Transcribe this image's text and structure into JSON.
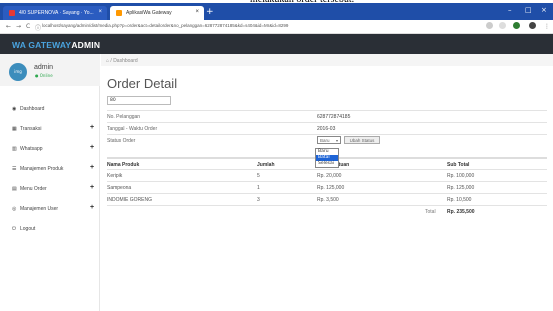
{
  "browser": {
    "tabs": [
      {
        "label": "4/0 SUPERNOVA · Sayang · Yo...",
        "close": "×"
      },
      {
        "label": "AplikasiWa Gateway",
        "close": "×"
      }
    ],
    "new_tab": "+",
    "controls": {
      "minimize": "–",
      "maximize": "□",
      "close": "×"
    },
    "nav": {
      "back": "←",
      "forward": "→",
      "reload": "C",
      "info": "ⓘ"
    },
    "url": "localhost/sayang/admin/dist/media.php?p=order&act=detailorder&no_pelanggan=628772874185&kd=s404&id=Mr&id=8299"
  },
  "app": {
    "brand_prefix": "WA GATEWAY",
    "brand_suffix": "ADMIN"
  },
  "sidebar": {
    "avatar": "img",
    "user_name": "admin",
    "user_status": "● Online",
    "items": [
      {
        "icon": "◉",
        "label": "Dashboard",
        "plus": ""
      },
      {
        "icon": "▦",
        "label": "Transaksi",
        "plus": "+"
      },
      {
        "icon": "▥",
        "label": "Whatsapp",
        "plus": "+"
      },
      {
        "icon": "☰",
        "label": "Manajemen Produk",
        "plus": "+"
      },
      {
        "icon": "▤",
        "label": "Menu Order",
        "plus": "+"
      },
      {
        "icon": "◎",
        "label": "Manajemen User",
        "plus": "+"
      },
      {
        "icon": "⏻",
        "label": "Logout",
        "plus": ""
      }
    ]
  },
  "main": {
    "breadcrumb": "⌂ / Dashboard",
    "title": "Order Detail",
    "order_no": "80",
    "info": [
      {
        "key": "No. Pelanggan",
        "value": "628772874185"
      },
      {
        "key": "Tanggal - Waktu Order",
        "value": "2016-03"
      },
      {
        "key": "Status Order",
        "value": ""
      }
    ],
    "status": {
      "selected": "Baru",
      "options": [
        "Baru",
        "Batal",
        "Selesai"
      ],
      "highlighted": "Batal",
      "button": "Ubah Status"
    },
    "table": {
      "headers": [
        "Nama Produk",
        "Jumlah",
        "Harga Satuan",
        "Sub Total"
      ],
      "rows": [
        [
          "Keripik",
          "5",
          "Rp. 20,000",
          "Rp. 100,000"
        ],
        [
          "Sampeona",
          "1",
          "Rp. 125,000",
          "Rp. 125,000"
        ],
        [
          "INDOMIE GORENG",
          "3",
          "Rp. 3,500",
          "Rp. 10,500"
        ]
      ],
      "total_label": "Total",
      "total_value": "Rp. 235,500"
    }
  },
  "colors": {
    "tabbar": "#1f4ea8",
    "appbar": "#2a2f36",
    "brand": "#4aa3df",
    "online": "#2fa84f",
    "highlight": "#1e64d6"
  }
}
